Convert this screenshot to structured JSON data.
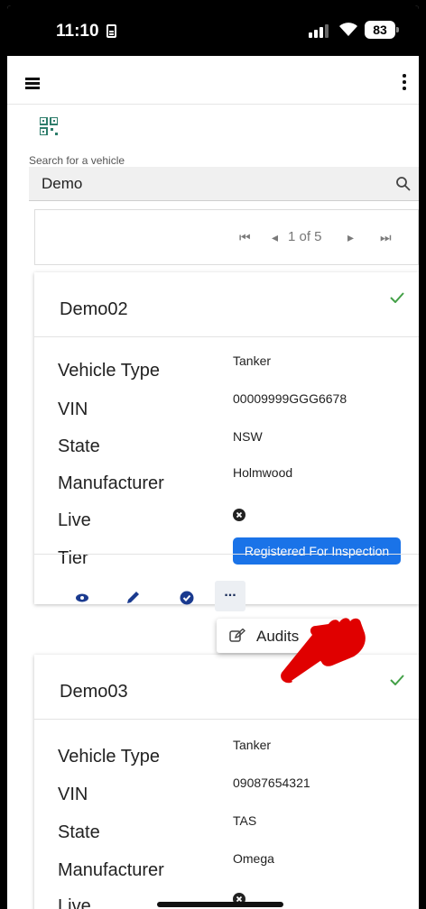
{
  "status": {
    "time": "11:10",
    "battery": "83"
  },
  "search": {
    "label": "Search for a vehicle",
    "value": "Demo"
  },
  "pager": {
    "text": "1 of 5"
  },
  "vehicles": [
    {
      "name": "Demo02",
      "fields": [
        {
          "label": "Vehicle Type",
          "value": "Tanker"
        },
        {
          "label": "VIN",
          "value": "00009999GGG6678"
        },
        {
          "label": "State",
          "value": "NSW"
        },
        {
          "label": "Manufacturer",
          "value": "Holmwood"
        },
        {
          "label": "Live",
          "value": ""
        },
        {
          "label": "Tier",
          "value": "Registered For Inspection"
        }
      ]
    },
    {
      "name": "Demo03",
      "fields": [
        {
          "label": "Vehicle Type",
          "value": "Tanker"
        },
        {
          "label": "VIN",
          "value": "09087654321"
        },
        {
          "label": "State",
          "value": "TAS"
        },
        {
          "label": "Manufacturer",
          "value": "Omega"
        },
        {
          "label": "Live",
          "value": ""
        }
      ]
    }
  ],
  "actions": {
    "more_label": "..."
  },
  "menu": {
    "items": [
      {
        "label": "Audits",
        "icon": "audit-edit-icon"
      }
    ]
  },
  "icons": {
    "view": "eye-icon",
    "edit": "pencil-icon",
    "approve": "check-circle-icon",
    "live_status": "x-circle-icon",
    "verified": "check-icon"
  },
  "colors": {
    "accent": "#1a73e8",
    "check": "#43a047",
    "pointer": "#e00000",
    "action_icon": "#1a3a8f"
  }
}
